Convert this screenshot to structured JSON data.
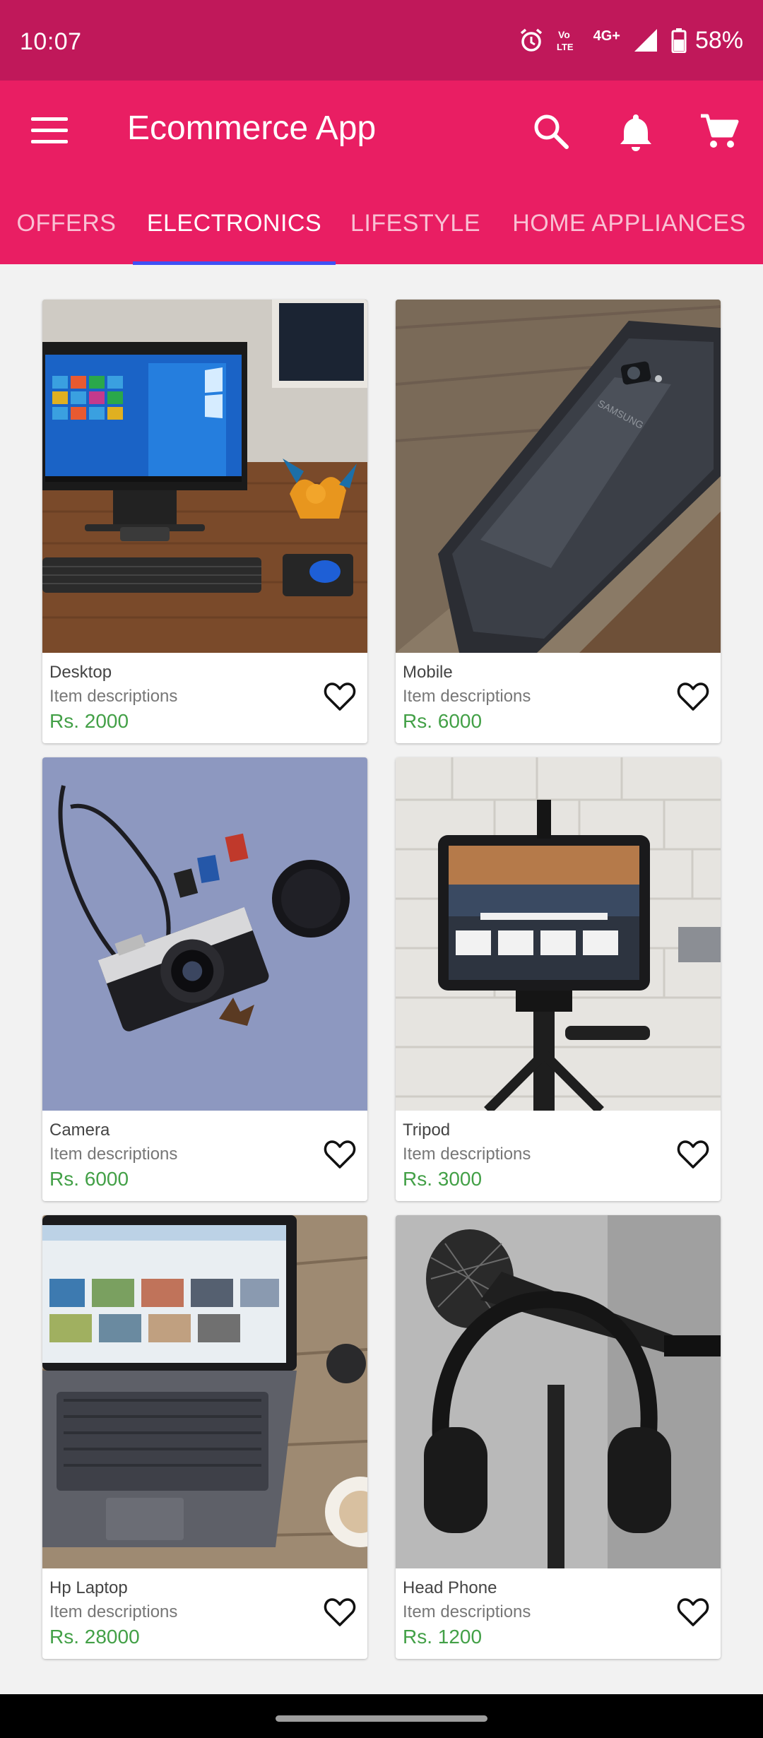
{
  "status_bar": {
    "time": "10:07",
    "network_top": "Vo",
    "network_bottom": "LTE",
    "network_type": "4G+",
    "battery": "58%",
    "icons": [
      "alarm-icon",
      "volte-icon",
      "signal-icon",
      "battery-icon"
    ]
  },
  "app_bar": {
    "title": "Ecommerce App",
    "icons": [
      "menu-icon",
      "search-icon",
      "bell-icon",
      "cart-icon"
    ],
    "background": "#e91e63",
    "status_background": "#c0185a"
  },
  "tabs": [
    {
      "label": "OFFERS",
      "active": false
    },
    {
      "label": "ELECTRONICS",
      "active": true
    },
    {
      "label": "LIFESTYLE",
      "active": false
    },
    {
      "label": "HOME APPLIANCES",
      "active": false
    }
  ],
  "accent_indicator": "#3f51f5",
  "price_color": "#43a047",
  "products": [
    {
      "name": "Desktop",
      "description": "Item descriptions",
      "price": "Rs. 2000",
      "image": "desktop-computer-photo"
    },
    {
      "name": "Mobile",
      "description": "Item descriptions",
      "price": "Rs. 6000",
      "image": "smartphone-photo"
    },
    {
      "name": "Camera",
      "description": "Item descriptions",
      "price": "Rs. 6000",
      "image": "film-camera-photo"
    },
    {
      "name": "Tripod",
      "description": "Item descriptions",
      "price": "Rs. 3000",
      "image": "tablet-on-tripod-photo"
    },
    {
      "name": "Hp Laptop",
      "description": "Item descriptions",
      "price": "Rs. 28000",
      "image": "laptop-photo"
    },
    {
      "name": "Head Phone",
      "description": "Item descriptions",
      "price": "Rs. 1200",
      "image": "headphones-microphone-photo"
    }
  ]
}
